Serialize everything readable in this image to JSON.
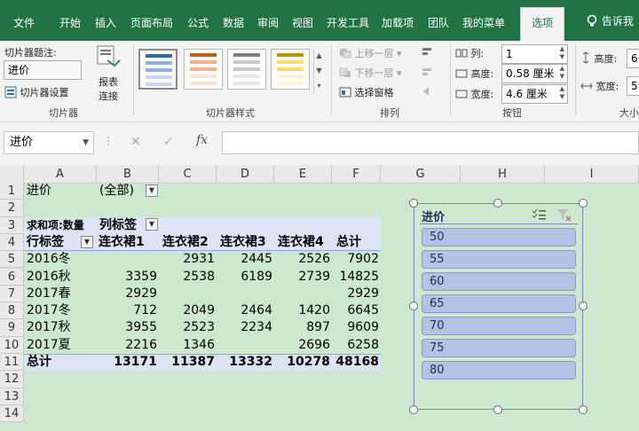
{
  "menu": {
    "file": "文件",
    "start": "开始",
    "insert": "插入",
    "layout": "页面布局",
    "formula": "公式",
    "data": "数据",
    "review": "审阅",
    "view": "视图",
    "dev": "开发工具",
    "addins": "加载项",
    "team": "团队",
    "mymenu": "我的菜单",
    "options": "选项",
    "tellme": "告诉我"
  },
  "ribbon": {
    "caption_label": "切片器题注:",
    "caption_value": "进价",
    "settings": "切片器设置",
    "report_conn_1": "报表",
    "report_conn_2": "连接",
    "group_slicer": "切片器",
    "group_styles": "切片器样式",
    "bring_forward": "上移一层",
    "send_backward": "下移一层",
    "selection_pane": "选择窗格",
    "group_arrange": "排列",
    "columns_label": "列:",
    "columns_value": "1",
    "height_label": "高度:",
    "height_value": "0.58 厘米",
    "width_label": "宽度:",
    "width_value": "4.6 厘米",
    "group_buttons": "按钮",
    "size_height_label": "高度:",
    "size_height_value": "6.",
    "size_width_label": "宽度:",
    "size_width_value": "5.",
    "group_size": "大小"
  },
  "formula": {
    "namebox": "进价",
    "cancel": "✕",
    "enter": "✓",
    "fx": "fx"
  },
  "colheaders": [
    "A",
    "B",
    "C",
    "D",
    "E",
    "F",
    "G",
    "H",
    "I"
  ],
  "rowheaders": [
    "1",
    "2",
    "3",
    "4",
    "5",
    "6",
    "7",
    "8",
    "9",
    "10",
    "11",
    "12",
    "13",
    "14"
  ],
  "pivot": {
    "filter_label": "进价",
    "filter_value": "(全部)",
    "sum_label": "求和项:数量",
    "col_label": "列标签",
    "row_label": "行标签",
    "col_headers": [
      "连衣裙1",
      "连衣裙2",
      "连衣裙3",
      "连衣裙4",
      "总计"
    ],
    "rows": [
      {
        "label": "2016冬",
        "values": [
          "",
          "2931",
          "2445",
          "2526",
          "7902"
        ]
      },
      {
        "label": "2016秋",
        "values": [
          "3359",
          "2538",
          "6189",
          "2739",
          "14825"
        ]
      },
      {
        "label": "2017春",
        "values": [
          "2929",
          "",
          "",
          "",
          "2929"
        ]
      },
      {
        "label": "2017冬",
        "values": [
          "712",
          "2049",
          "2464",
          "1420",
          "6645"
        ]
      },
      {
        "label": "2017秋",
        "values": [
          "3955",
          "2523",
          "2234",
          "897",
          "9609"
        ]
      },
      {
        "label": "2017夏",
        "values": [
          "2216",
          "1346",
          "",
          "2696",
          "6258"
        ]
      }
    ],
    "total_label": "总计",
    "total_values": [
      "13171",
      "11387",
      "13332",
      "10278",
      "48168"
    ]
  },
  "slicer": {
    "title": "进价",
    "items": [
      "50",
      "55",
      "60",
      "65",
      "70",
      "75",
      "80"
    ]
  },
  "colors": {
    "accent": "#217346",
    "sheet": "#cce8cf",
    "slicer_item": "#b3c3e6"
  }
}
